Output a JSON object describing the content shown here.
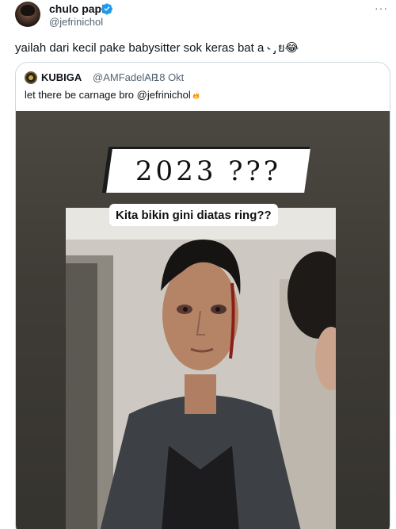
{
  "author": {
    "display_name": "chulo papi",
    "handle": "@jefrinichol",
    "verified": true
  },
  "tweet": {
    "text": "yailah dari kecil pake babysitter sok keras bat a ˞ ̡ ย😂"
  },
  "menu": {
    "more_glyph": "···"
  },
  "quote": {
    "display_name": "KUBIGA",
    "handle": "@AMFadelAP",
    "separator": "·",
    "date": "18 Okt",
    "text": "let there be carnage bro @jefrinichol",
    "emoji": "fire-icon"
  },
  "media": {
    "caption_year": "2023 ???",
    "caption_question": "Kita bikin gini diatas ring??"
  },
  "colors": {
    "verified_blue": "#1d9bf0",
    "secondary_text": "#536471",
    "border": "#cfd9de"
  }
}
